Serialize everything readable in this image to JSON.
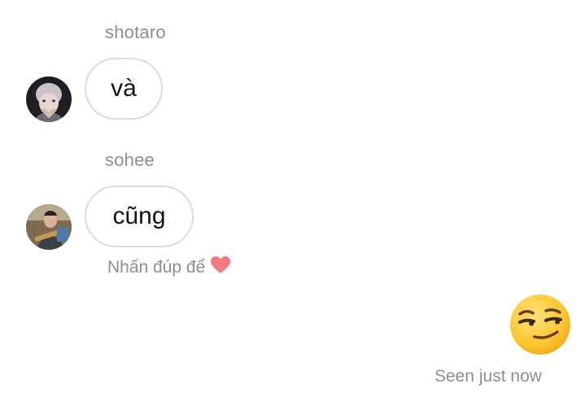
{
  "messages": [
    {
      "sender": "shotaro",
      "text": "và"
    },
    {
      "sender": "sohee",
      "text": "cũng",
      "hint": "Nhấn đúp để"
    }
  ],
  "reply": {
    "emoji_icon": "smirking-face-icon"
  },
  "status": {
    "seen_text": "Seen just now"
  },
  "colors": {
    "heart": "#f07b7f",
    "muted_text": "#8e8e8e",
    "bubble_border": "#dbdbdb"
  }
}
